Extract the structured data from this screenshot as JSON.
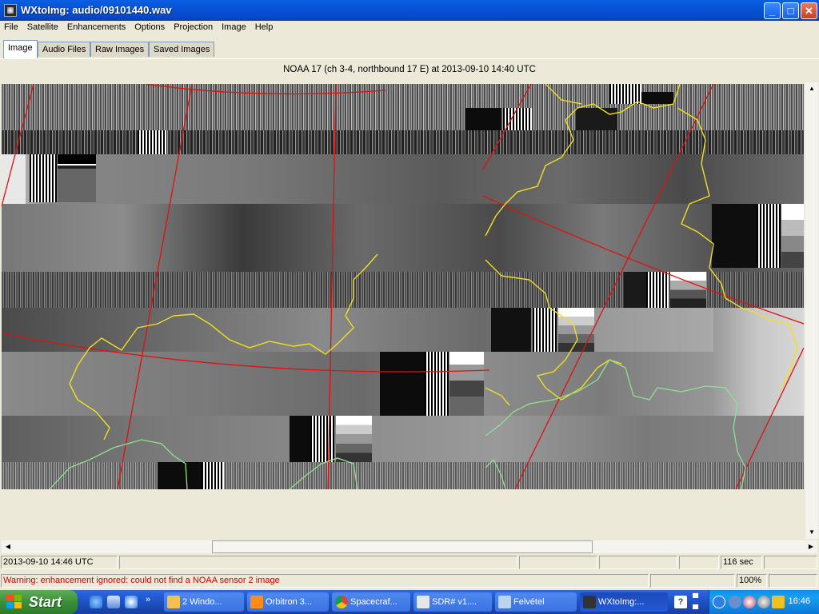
{
  "window": {
    "title": "WXtoImg: audio/09101440.wav",
    "controls": {
      "minimize": "_",
      "maximize": "□",
      "close": "✕"
    }
  },
  "menu": [
    "File",
    "Satellite",
    "Enhancements",
    "Options",
    "Projection",
    "Image",
    "Help"
  ],
  "tabs": [
    {
      "label": "Image",
      "active": true
    },
    {
      "label": "Audio Files",
      "active": false
    },
    {
      "label": "Raw Images",
      "active": false
    },
    {
      "label": "Saved Images",
      "active": false
    }
  ],
  "image_caption": "NOAA 17 (ch 3-4, northbound 17 E) at 2013-09-10  14:40 UTC",
  "status": {
    "datetime": "2013-09-10  14:46 UTC",
    "elapsed": "116 sec",
    "warning": "Warning: enhancement ignored: could not find a NOAA sensor 2 image",
    "zoom": "100%",
    "warning_color": "#cc0000"
  },
  "overlay_colors": {
    "grid": "#e01010",
    "borders": "#f0e020",
    "coast": "#90e090"
  },
  "taskbar": {
    "start_label": "Start",
    "quick_launch": [
      "ie-icon",
      "desktop-icon",
      "explorer-icon"
    ],
    "quick_launch_more": "»",
    "tasks": [
      {
        "label": "2 Windo...",
        "icon": "folder-icon",
        "active": false
      },
      {
        "label": "Orbitron 3...",
        "icon": "orbitron-icon",
        "active": false
      },
      {
        "label": "Spacecraf...",
        "icon": "chrome-icon",
        "active": false
      },
      {
        "label": "SDR# v1....",
        "icon": "sdr-icon",
        "active": false
      },
      {
        "label": "Felvétel",
        "icon": "recorder-icon",
        "active": false
      },
      {
        "label": "WXtoImg:...",
        "icon": "wxtoimg-icon",
        "active": true
      }
    ],
    "clock": "16:46"
  }
}
